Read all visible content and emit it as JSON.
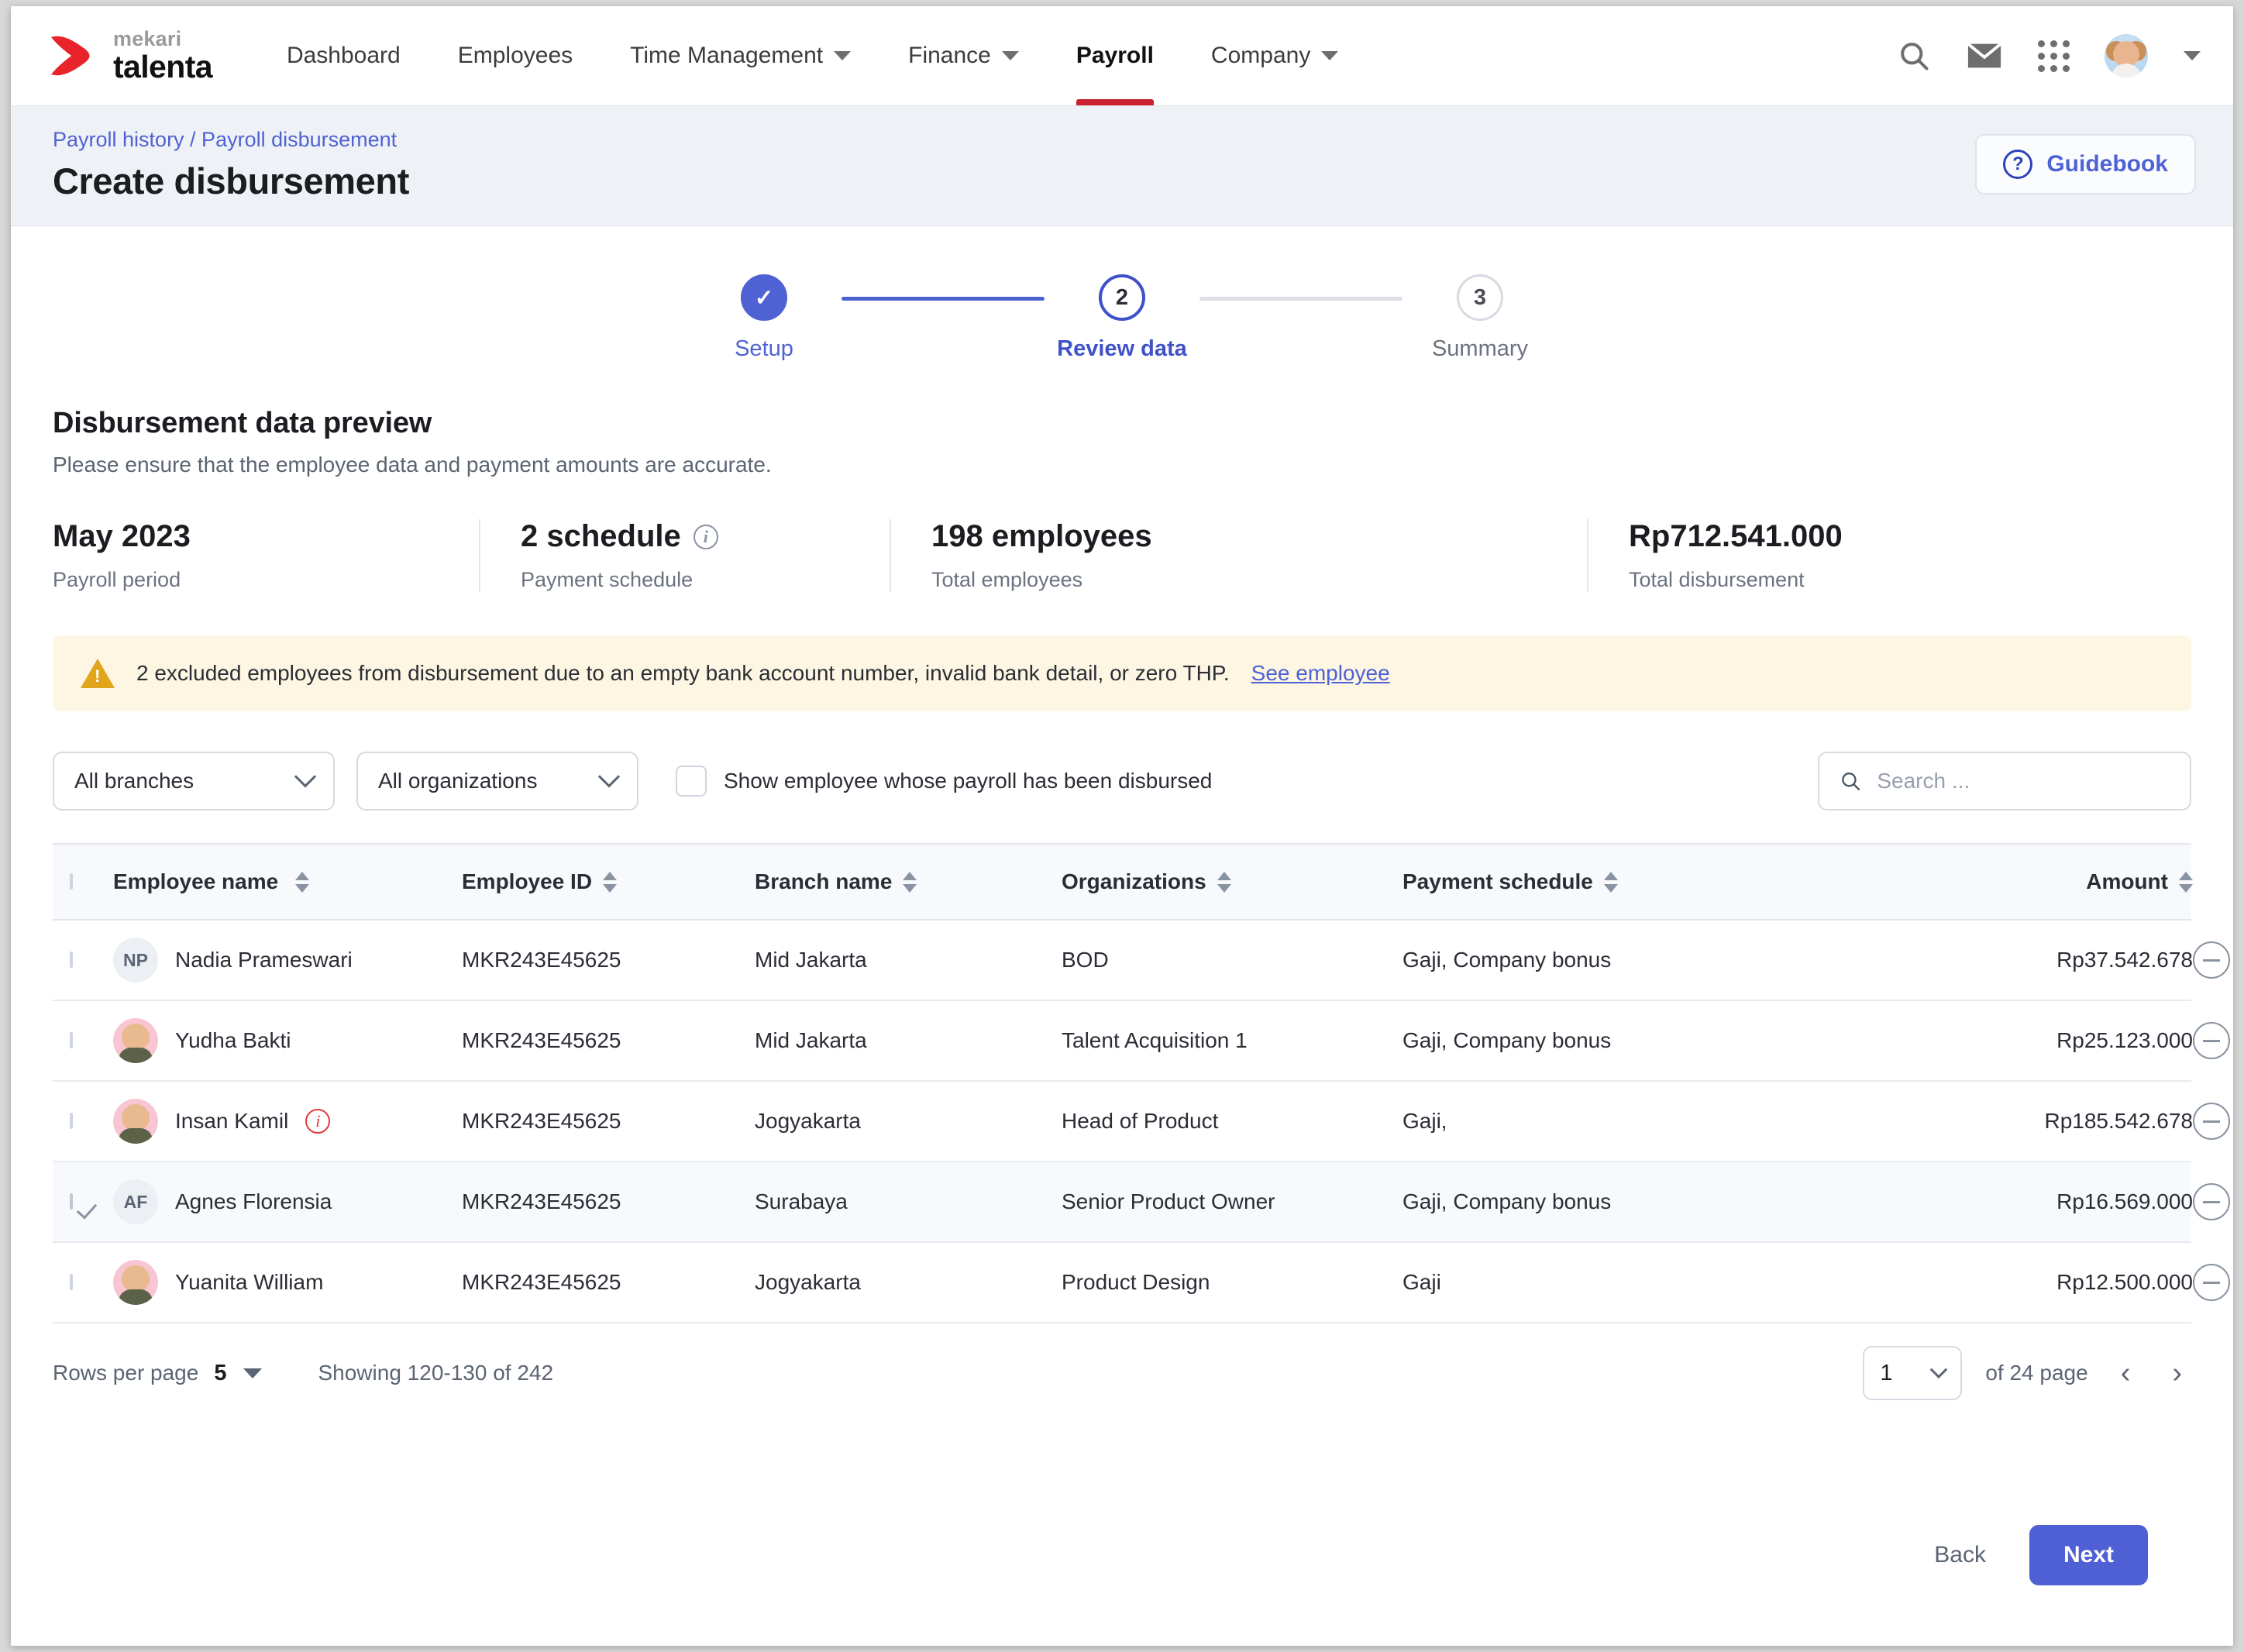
{
  "nav": {
    "brand_top": "mekari",
    "brand_bottom": "talenta",
    "items": [
      {
        "label": "Dashboard",
        "has_caret": false,
        "active": false
      },
      {
        "label": "Employees",
        "has_caret": false,
        "active": false
      },
      {
        "label": "Time Management",
        "has_caret": true,
        "active": false
      },
      {
        "label": "Finance",
        "has_caret": true,
        "active": false
      },
      {
        "label": "Payroll",
        "has_caret": false,
        "active": true
      },
      {
        "label": "Company",
        "has_caret": true,
        "active": false
      }
    ],
    "icons": [
      "search-icon",
      "mail-icon",
      "apps-grid-icon",
      "avatar",
      "chevron-down-icon"
    ]
  },
  "header": {
    "breadcrumb": "Payroll history / Payroll disbursement",
    "title": "Create disbursement",
    "guidebook_label": "Guidebook",
    "guidebook_icon": "question-circle-icon"
  },
  "stepper": {
    "steps": [
      {
        "marker": "✓",
        "label": "Setup",
        "state": "done"
      },
      {
        "marker": "2",
        "label": "Review data",
        "state": "current"
      },
      {
        "marker": "3",
        "label": "Summary",
        "state": "todo"
      }
    ]
  },
  "preview": {
    "title": "Disbursement data preview",
    "subtitle": "Please ensure that the employee data and payment amounts are accurate.",
    "stats": [
      {
        "value": "May 2023",
        "label": "Payroll period",
        "info": false
      },
      {
        "value": "2 schedule",
        "label": "Payment schedule",
        "info": true
      },
      {
        "value": "198 employees",
        "label": "Total employees",
        "info": false
      },
      {
        "value": "Rp712.541.000",
        "label": "Total disbursement",
        "info": false
      }
    ]
  },
  "alert": {
    "icon": "warning-triangle-icon",
    "text": "2 excluded employees from disbursement due to an empty bank account number, invalid bank detail, or zero THP.",
    "link": "See employee"
  },
  "filters": {
    "branch_value": "All branches",
    "organization_value": "All organizations",
    "checkbox_label": "Show employee whose payroll has been disbursed",
    "checkbox_checked": false,
    "search_placeholder": "Search ...",
    "search_value": ""
  },
  "table": {
    "columns": [
      {
        "key": "name",
        "label": "Employee name",
        "sortable": true
      },
      {
        "key": "id",
        "label": "Employee ID",
        "sortable": true
      },
      {
        "key": "branch",
        "label": "Branch name",
        "sortable": true
      },
      {
        "key": "org",
        "label": "Organizations",
        "sortable": true
      },
      {
        "key": "schedule",
        "label": "Payment schedule",
        "sortable": true
      },
      {
        "key": "amount",
        "label": "Amount",
        "sortable": true
      }
    ],
    "header_checkbox_checked": false,
    "rows": [
      {
        "checked": false,
        "selected": false,
        "avatar_type": "initials",
        "initials": "NP",
        "name": "Nadia Prameswari",
        "warning": false,
        "id": "MKR243E45625",
        "branch": "Mid Jakarta",
        "org": "BOD",
        "schedule": "Gaji, Company bonus",
        "amount": "Rp37.542.678"
      },
      {
        "checked": false,
        "selected": false,
        "avatar_type": "photo",
        "initials": "",
        "name": "Yudha Bakti",
        "warning": false,
        "id": "MKR243E45625",
        "branch": "Mid Jakarta",
        "org": "Talent Acquisition 1",
        "schedule": "Gaji, Company bonus",
        "amount": "Rp25.123.000"
      },
      {
        "checked": false,
        "selected": false,
        "avatar_type": "photo",
        "initials": "",
        "name": "Insan Kamil",
        "warning": true,
        "id": "MKR243E45625",
        "branch": "Jogyakarta",
        "org": "Head of Product",
        "schedule": "Gaji,",
        "amount": "Rp185.542.678"
      },
      {
        "checked": true,
        "selected": true,
        "avatar_type": "initials",
        "initials": "AF",
        "name": "Agnes Florensia",
        "warning": false,
        "id": "MKR243E45625",
        "branch": "Surabaya",
        "org": "Senior Product Owner",
        "schedule": "Gaji, Company bonus",
        "amount": "Rp16.569.000"
      },
      {
        "checked": false,
        "selected": false,
        "avatar_type": "photo",
        "initials": "",
        "name": "Yuanita William",
        "warning": false,
        "id": "MKR243E45625",
        "branch": "Jogyakarta",
        "org": "Product Design",
        "schedule": "Gaji",
        "amount": "Rp12.500.000"
      }
    ]
  },
  "pagination": {
    "rows_per_page_label": "Rows per page",
    "rows_per_page_value": "5",
    "showing": "Showing 120-130 of 242",
    "page_value": "1",
    "of_pages": "of 24 page",
    "prev_icon": "chevron-left-icon",
    "next_icon": "chevron-right-icon"
  },
  "footer": {
    "back_label": "Back",
    "next_label": "Next"
  },
  "colors": {
    "brand_red": "#c8202f",
    "primary": "#4f5fd4",
    "link": "#4f62d4",
    "warning_bg": "#fdf6e3",
    "warning_icon": "#e0a51b",
    "error": "#e23a3a",
    "header_bg": "#eef1f6"
  }
}
